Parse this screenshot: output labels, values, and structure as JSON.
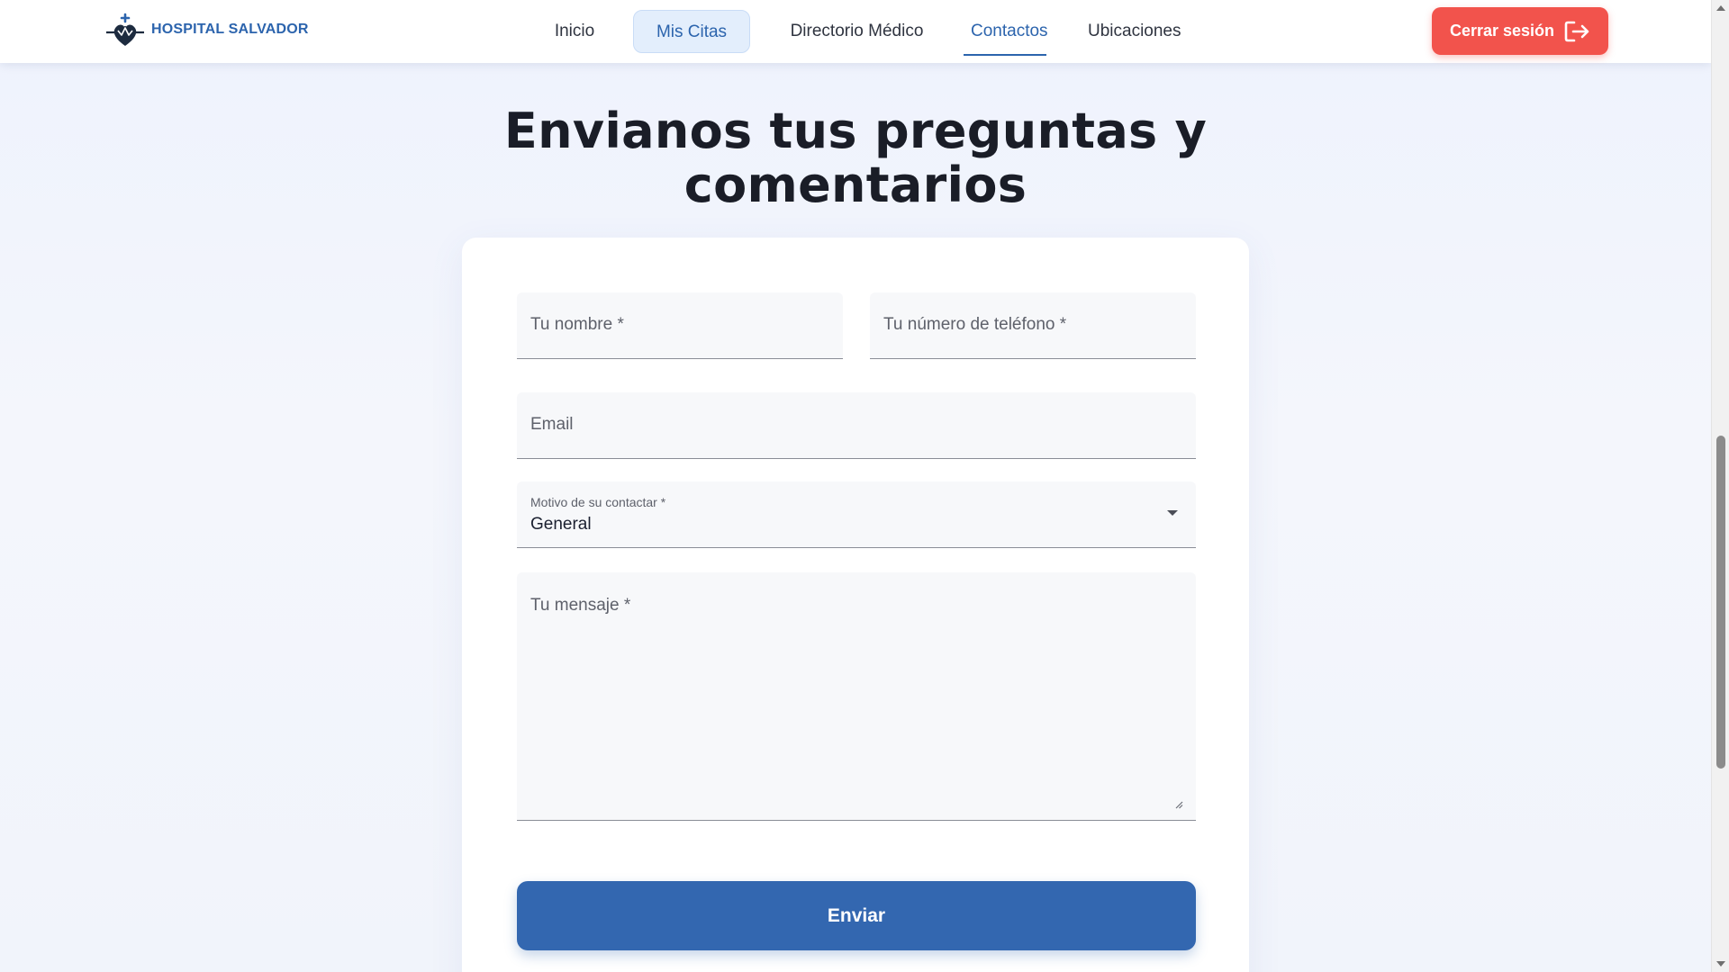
{
  "header": {
    "brand_name": "HOSPITAL SALVADOR",
    "logo_icon": "hospital-heart-cross-logo",
    "nav": [
      {
        "label": "Inicio"
      },
      {
        "label": "Mis Citas",
        "highlighted": true
      },
      {
        "label": "Directorio Médico"
      },
      {
        "label": "Contactos",
        "active": true
      },
      {
        "label": "Ubicaciones"
      }
    ],
    "logout_label": "Cerrar sesión",
    "logout_icon": "logout-arrow-icon"
  },
  "main": {
    "title_line1": "Envianos tus preguntas y",
    "title_line2": "comentarios"
  },
  "form": {
    "name_placeholder": "Tu nombre *",
    "phone_placeholder": "Tu número de teléfono *",
    "email_placeholder": "Email",
    "reason_label": "Motivo de su contactar *",
    "reason_value": "General",
    "message_placeholder": "Tu mensaje *",
    "submit_label": "Enviar"
  },
  "colors": {
    "brand_blue": "#2c64ad",
    "button_blue": "#3367b0",
    "logout_red": "#f2534c",
    "active_nav_bg": "#e3eefc"
  }
}
